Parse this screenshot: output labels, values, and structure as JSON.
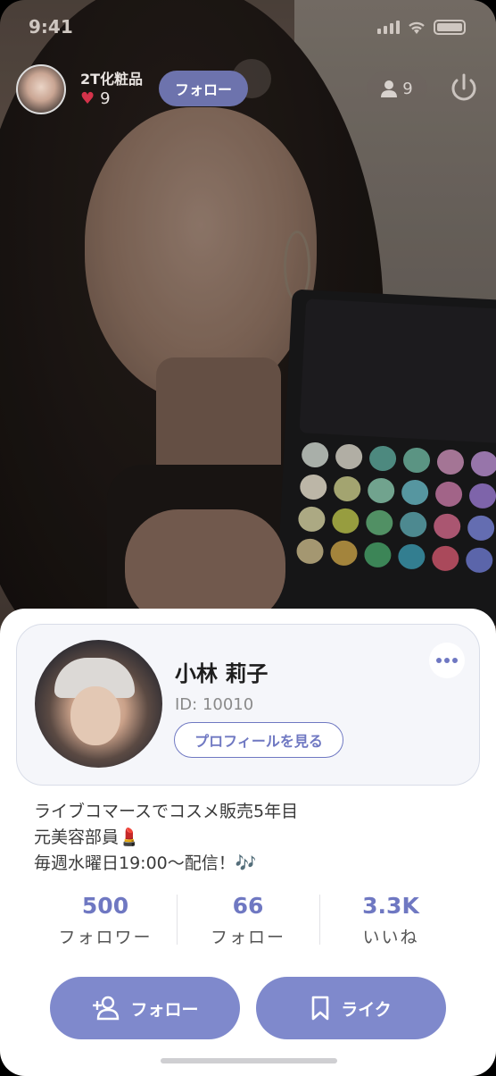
{
  "status_bar": {
    "time": "9:41"
  },
  "header": {
    "shop_name": "2T化粧品",
    "likes": "9",
    "follow_label": "フォロー",
    "viewers": "9"
  },
  "profile": {
    "name": "小林 莉子",
    "id": "ID: 10010",
    "view_profile_label": "プロフィールを見る",
    "bio": [
      "ライブコマースでコスメ販売5年目",
      "元美容部員💄",
      "毎週水曜日19:00〜配信！🎶"
    ]
  },
  "stats": [
    {
      "value": "500",
      "label": "フォロワー"
    },
    {
      "value": "66",
      "label": "フォロー"
    },
    {
      "value": "3.3K",
      "label": "いいね"
    }
  ],
  "actions": {
    "follow_label": "フォロー",
    "like_label": "ライク"
  },
  "colors": {
    "accent": "#7f89cc",
    "accent_dark": "#6f78c2",
    "heart": "#d4334a"
  },
  "palette_colors": [
    "#cfd6cf",
    "#d8d5c8",
    "#5fa89b",
    "#6fb5a0",
    "#c98fb6",
    "#b98fd0",
    "#e6dfcc",
    "#c7c989",
    "#8ac7ae",
    "#69b7c4",
    "#c67aa6",
    "#9a7bd0",
    "#d2cfa0",
    "#b9c04d",
    "#63b07a",
    "#5fa8b0",
    "#d06a8a",
    "#7b86d8",
    "#c9b98a",
    "#c7a24a",
    "#4aa36b",
    "#3f9ab0",
    "#d05a70",
    "#6f7cd0"
  ]
}
